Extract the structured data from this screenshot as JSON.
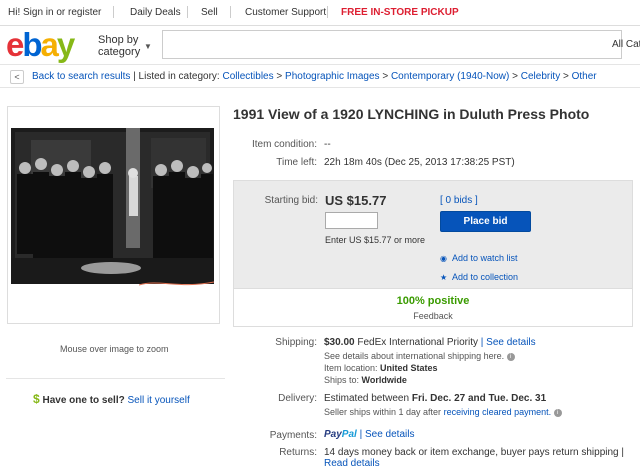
{
  "topbar": {
    "greeting": "Hi! Sign in or register",
    "daily_deals": "Daily Deals",
    "sell": "Sell",
    "support": "Customer Support",
    "pickup": "FREE IN-STORE PICKUP"
  },
  "header": {
    "logo": [
      "e",
      "b",
      "a",
      "y"
    ],
    "shop_by_line1": "Shop by",
    "shop_by_line2": "category",
    "search_category": "All Cat"
  },
  "breadcrumb": {
    "back": "Back to search results",
    "listed_in": "| Listed in category:",
    "items": [
      "Collectibles",
      "Photographic Images",
      "Contemporary (1940-Now)",
      "Celebrity",
      "Other"
    ],
    "separator": ">"
  },
  "listing": {
    "title": "1991 View of a 1920 LYNCHING in Duluth Press Photo",
    "condition_label": "Item condition:",
    "condition_value": "--",
    "time_left_label": "Time left:",
    "time_left_value": "22h 18m 40s",
    "time_left_date": "(Dec 25, 2013  17:38:25 PST)",
    "zoom_hint": "Mouse over image to zoom"
  },
  "bid": {
    "starting_bid_label": "Starting bid:",
    "price": "US $15.77",
    "bids": "[ 0 bids ]",
    "input_value": "",
    "enter_hint": "Enter US $15.77 or more",
    "place_bid": "Place bid",
    "watch": "Add to watch list",
    "collection": "Add to collection",
    "positive": "100% positive",
    "feedback": "Feedback"
  },
  "shipping": {
    "label": "Shipping:",
    "cost": "$30.00",
    "method": "FedEx International Priority",
    "see_details": "| See details",
    "intl": "See details about international shipping here.",
    "location_label": "Item location:",
    "location": "United States",
    "ships_to_label": "Ships to:",
    "ships_to": "Worldwide"
  },
  "delivery": {
    "label": "Delivery:",
    "estimate": "Estimated between",
    "dates": "Fri. Dec. 27 and Tue. Dec. 31",
    "ships_within": "Seller ships within 1 day after",
    "cleared": "receiving cleared payment."
  },
  "payments": {
    "label": "Payments:",
    "paypal_1": "Pay",
    "paypal_2": "Pal",
    "see_details": "| See details"
  },
  "returns": {
    "label": "Returns:",
    "text": "14 days money back or item exchange, buyer pays return shipping |",
    "read_details": "Read details"
  },
  "sell_promo": {
    "dollar": "$",
    "question": "Have one to sell?",
    "link": "Sell it yourself"
  }
}
